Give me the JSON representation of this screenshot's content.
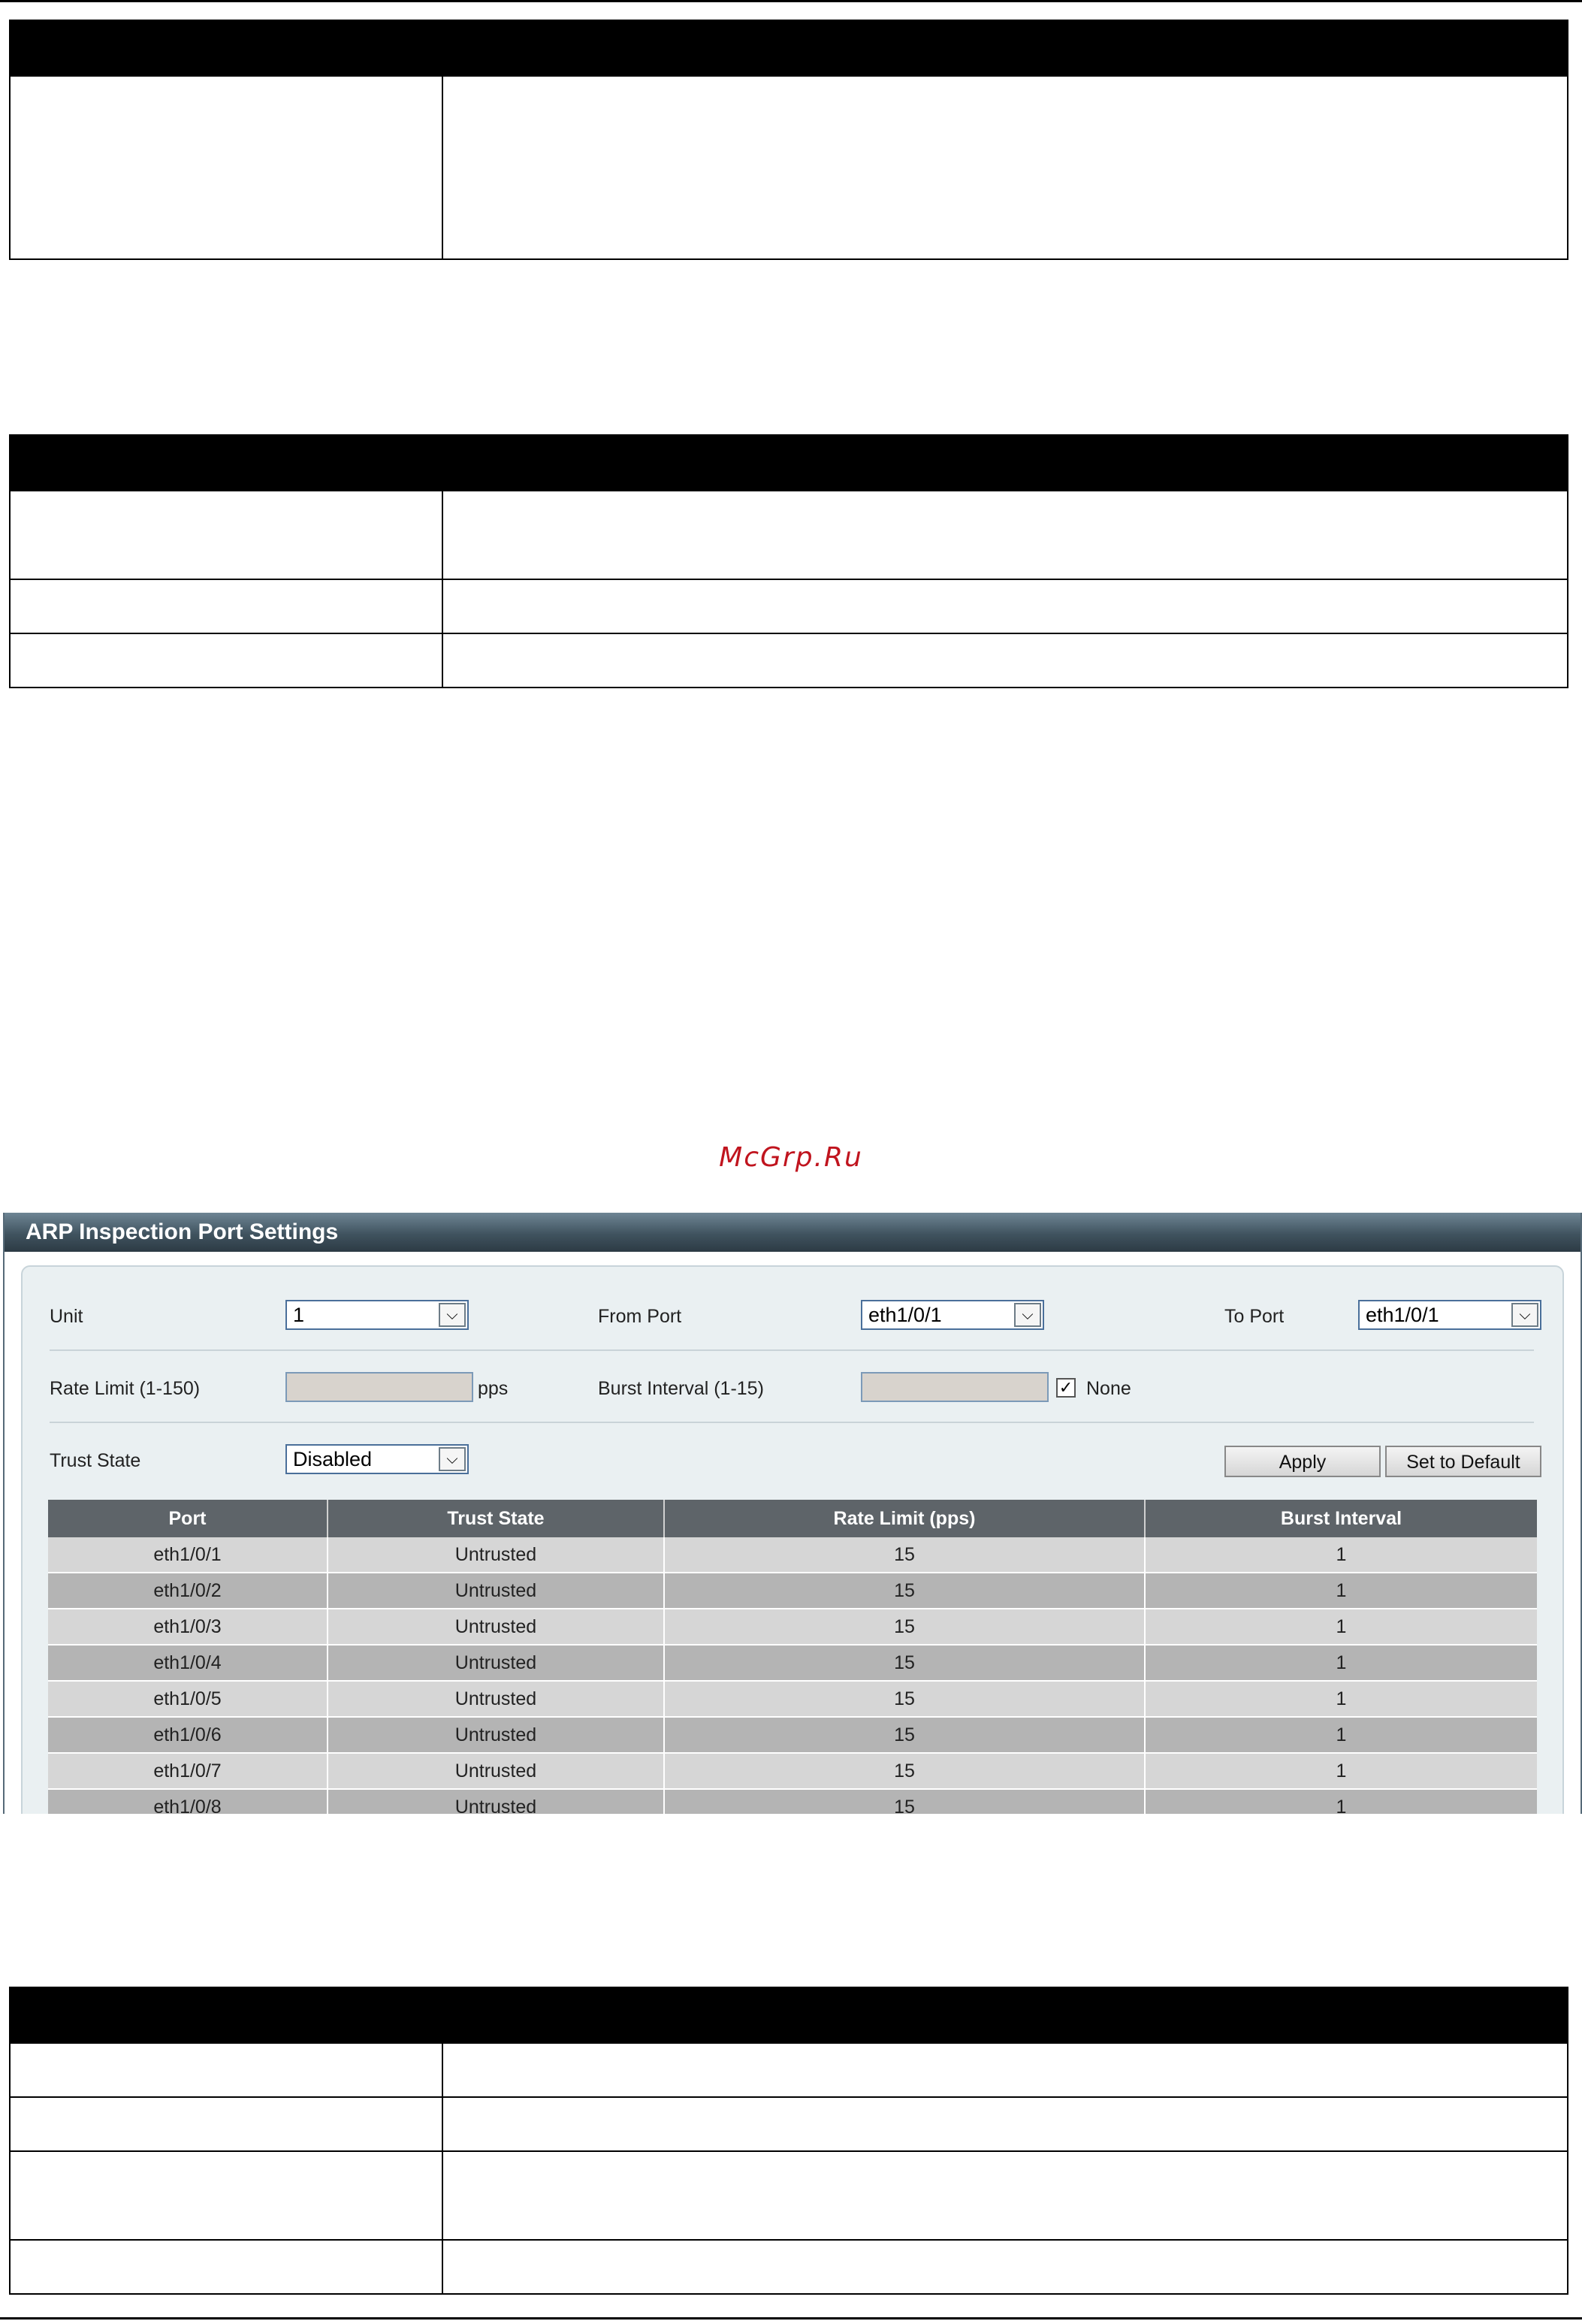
{
  "watermark": "McGrp.Ru",
  "colors": {
    "watermark": "#c0141e",
    "title_bar": "#40535f",
    "panel_bg": "#eaf0f2",
    "grid_header": "#5e6469",
    "row_light": "#d6d6d6",
    "row_dark": "#b4b4b4"
  },
  "panel": {
    "title": "ARP Inspection Port Settings",
    "unit": {
      "label": "Unit",
      "value": "1"
    },
    "from_port": {
      "label": "From Port",
      "value": "eth1/0/1"
    },
    "to_port": {
      "label": "To Port",
      "value": "eth1/0/1"
    },
    "rate_limit": {
      "label": "Rate Limit (1-150)",
      "value": "",
      "unit": "pps"
    },
    "burst_interval": {
      "label": "Burst Interval (1-15)",
      "value": "",
      "none_label": "None",
      "none_checked": true
    },
    "trust_state": {
      "label": "Trust State",
      "value": "Disabled"
    },
    "buttons": {
      "apply": "Apply",
      "default": "Set to Default"
    },
    "table": {
      "headers": [
        "Port",
        "Trust State",
        "Rate Limit (pps)",
        "Burst Interval"
      ],
      "rows": [
        [
          "eth1/0/1",
          "Untrusted",
          "15",
          "1"
        ],
        [
          "eth1/0/2",
          "Untrusted",
          "15",
          "1"
        ],
        [
          "eth1/0/3",
          "Untrusted",
          "15",
          "1"
        ],
        [
          "eth1/0/4",
          "Untrusted",
          "15",
          "1"
        ],
        [
          "eth1/0/5",
          "Untrusted",
          "15",
          "1"
        ],
        [
          "eth1/0/6",
          "Untrusted",
          "15",
          "1"
        ],
        [
          "eth1/0/7",
          "Untrusted",
          "15",
          "1"
        ],
        [
          "eth1/0/8",
          "Untrusted",
          "15",
          "1"
        ]
      ]
    }
  }
}
